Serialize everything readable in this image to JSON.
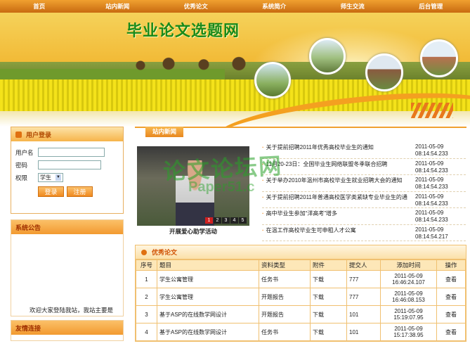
{
  "nav": [
    "首页",
    "站内新闻",
    "优秀论文",
    "系统简介",
    "师生交流",
    "后台管理"
  ],
  "site_title": "毕业论文选题网",
  "login": {
    "title": "用户登录",
    "username_label": "用户名",
    "password_label": "密码",
    "role_label": "权限",
    "role_value": "学生",
    "login_button": "登录",
    "register_button": "注册"
  },
  "notice": {
    "title": "系统公告",
    "text": "欢迎大家登陆我站，我站主要是"
  },
  "links": {
    "title": "友情连接"
  },
  "news": {
    "tab": "站内新闻",
    "caption": "开展爱心助学活动",
    "pager": [
      "1",
      "2",
      "3",
      "4",
      "5"
    ],
    "items": [
      {
        "title": "关于提前招聘2011年优秀高校毕业生的通知",
        "date": "2011-05-09",
        "time": "08:14:54.233"
      },
      {
        "title": "11月20-23日：全国毕业生网络联盟冬季联合招聘",
        "date": "2011-05-09",
        "time": "08:14:54.233"
      },
      {
        "title": "关于举办2010年温州市高校毕业生就业招聘大会的通知",
        "date": "2011-05-09",
        "time": "08:14:54.233"
      },
      {
        "title": "关于提前招聘2011年普通高校医学类紧缺专业毕业生的通",
        "date": "2011-05-09",
        "time": "08:14:54.233"
      },
      {
        "title": "高中毕业生参加“洋高考”增多",
        "date": "2011-05-09",
        "time": "08:14:54.233"
      },
      {
        "title": "在温工作高校毕业生可申租人才公寓",
        "date": "2011-05-09",
        "time": "08:14:54.217"
      }
    ]
  },
  "watermark": {
    "main": "论文论坛网",
    "sub": "Paper51.c"
  },
  "papers": {
    "title": "优秀论文",
    "headers": [
      "序号",
      "题目",
      "资料类型",
      "附件",
      "提交人",
      "添加时间",
      "操作"
    ],
    "rows": [
      {
        "no": "1",
        "title": "学生公寓管理",
        "type": "任务书",
        "att": "下载",
        "user": "777",
        "date": "2011-05-09",
        "time": "16:46:24.107",
        "op": "查看"
      },
      {
        "no": "2",
        "title": "学生公寓管理",
        "type": "开题报告",
        "att": "下载",
        "user": "777",
        "date": "2011-05-09",
        "time": "16:46:08.153",
        "op": "查看"
      },
      {
        "no": "3",
        "title": "基于ASP的在线数学网设计",
        "type": "开题报告",
        "att": "下载",
        "user": "101",
        "date": "2011-05-09",
        "time": "15:19:07.95",
        "op": "查看"
      },
      {
        "no": "4",
        "title": "基于ASP的在线数学网设计",
        "type": "任务书",
        "att": "下载",
        "user": "101",
        "date": "2011-05-09",
        "time": "15:17:38.95",
        "op": "查看"
      }
    ]
  }
}
